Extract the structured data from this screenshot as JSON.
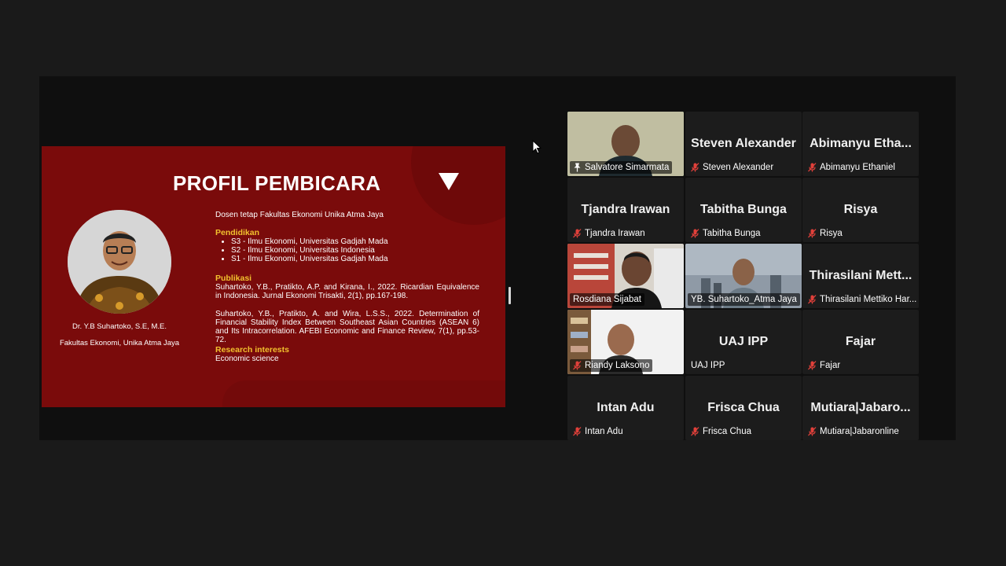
{
  "slide": {
    "title": "PROFIL PEMBICARA",
    "speaker_name": "Dr. Y.B Suhartoko, S.E, M.E.",
    "speaker_affiliation": "Fakultas Ekonomi, Unika Atma Jaya",
    "intro": "Dosen tetap Fakultas Ekonomi Unika Atma Jaya",
    "education_heading": "Pendidikan",
    "education": [
      "S3 - Ilmu Ekonomi, Universitas Gadjah Mada",
      "S2 - Ilmu Ekonomi, Universitas Indonesia",
      "S1 - Ilmu Ekonomi, Universitas Gadjah Mada"
    ],
    "publications_heading": "Publikasi",
    "publications": [
      "Suhartoko, Y.B., Pratikto, A.P. and Kirana, I., 2022. Ricardian Equivalence in Indonesia. Jurnal Ekonomi Trisakti, 2(1), pp.167-198.",
      "Suhartoko, Y.B., Pratikto, A. and Wira, L.S.S., 2022. Determination of Financial Stability Index Between Southeast Asian Countries (ASEAN 6) and Its Intracorrelation. AFEBI Economic and Finance Review, 7(1), pp.53-72."
    ],
    "research_heading": "Research interests",
    "research": "Economic science"
  },
  "participants": [
    {
      "label": "Salvatore Simarmata",
      "big": "",
      "mic": "pin-icon",
      "video": true,
      "active": true
    },
    {
      "label": "Steven Alexander",
      "big": "Steven Alexander",
      "mic": "mic-muted-icon",
      "video": false
    },
    {
      "label": "Abimanyu Ethaniel",
      "big": "Abimanyu  Etha...",
      "mic": "mic-muted-icon",
      "video": false
    },
    {
      "label": "Tjandra Irawan",
      "big": "Tjandra Irawan",
      "mic": "mic-muted-icon",
      "video": false
    },
    {
      "label": "Tabitha Bunga",
      "big": "Tabitha Bunga",
      "mic": "mic-muted-icon",
      "video": false
    },
    {
      "label": "Risya",
      "big": "Risya",
      "mic": "mic-muted-icon",
      "video": false
    },
    {
      "label": "Rosdiana Sijabat",
      "big": "",
      "mic": "none",
      "video": true
    },
    {
      "label": "YB. Suhartoko_Atma Jaya",
      "big": "",
      "mic": "none",
      "video": true
    },
    {
      "label": "Thirasilani Mettiko Har...",
      "big": "Thirasilani  Mett...",
      "mic": "mic-muted-icon",
      "video": false
    },
    {
      "label": "Riandy Laksono",
      "big": "",
      "mic": "mic-muted-icon",
      "video": true
    },
    {
      "label": "UAJ IPP",
      "big": "UAJ IPP",
      "mic": "none",
      "video": false
    },
    {
      "label": "Fajar",
      "big": "Fajar",
      "mic": "mic-muted-icon",
      "video": false
    },
    {
      "label": "Intan Adu",
      "big": "Intan Adu",
      "mic": "mic-muted-icon",
      "video": false
    },
    {
      "label": "Frisca Chua",
      "big": "Frisca Chua",
      "mic": "mic-muted-icon",
      "video": false
    },
    {
      "label": "Mutiara|Jabaronline",
      "big": "Mutiara|Jabaro...",
      "mic": "mic-muted-icon",
      "video": false
    }
  ]
}
